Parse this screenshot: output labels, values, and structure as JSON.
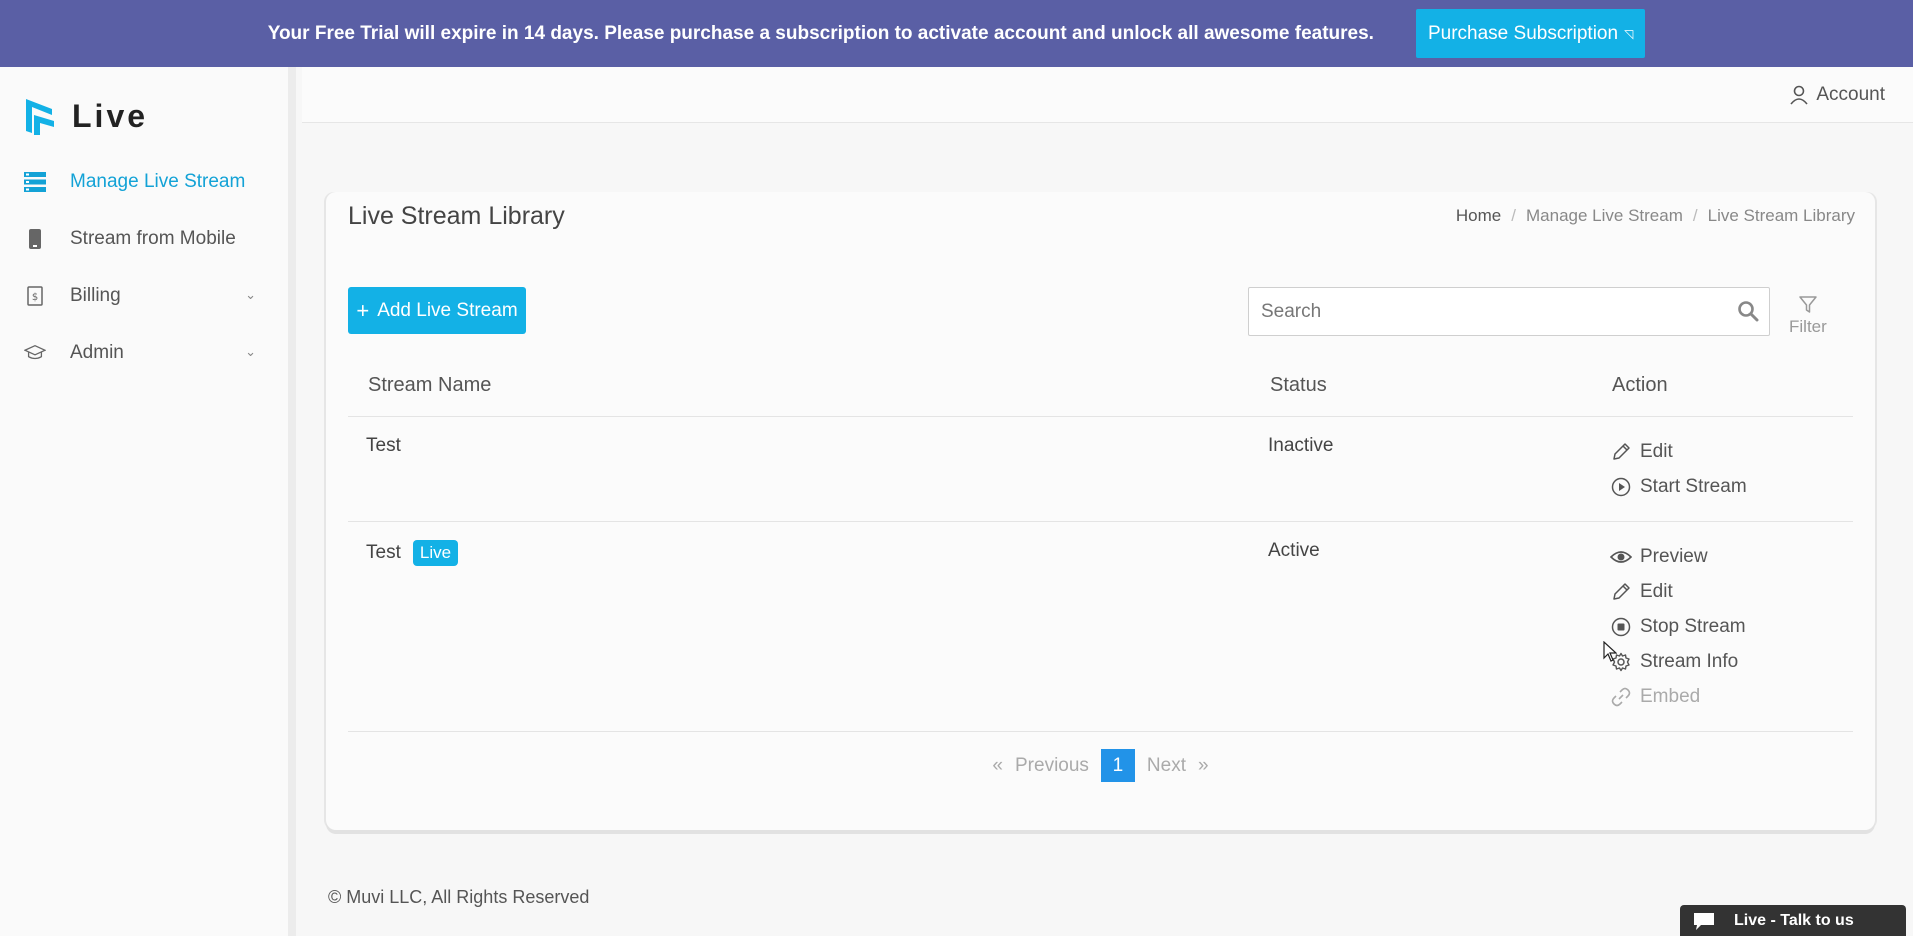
{
  "banner": {
    "message": "Your Free Trial will expire in 14 days. Please purchase a subscription to activate account and unlock all awesome features.",
    "button_label": "Purchase Subscription"
  },
  "sidebar": {
    "logo_text": "Live",
    "items": [
      {
        "label": "Manage Live Stream",
        "icon": "stream-list-icon",
        "active": true
      },
      {
        "label": "Stream from Mobile",
        "icon": "mobile-icon"
      },
      {
        "label": "Billing",
        "icon": "invoice-icon",
        "expandable": true
      },
      {
        "label": "Admin",
        "icon": "graduation-cap-icon",
        "expandable": true
      }
    ]
  },
  "header": {
    "account_label": "Account"
  },
  "page": {
    "title": "Live Stream Library",
    "breadcrumb": [
      "Home",
      "Manage Live Stream",
      "Live Stream Library"
    ],
    "add_button": "Add Live Stream",
    "search_placeholder": "Search",
    "filter_label": "Filter"
  },
  "table": {
    "columns": [
      "Stream Name",
      "Status",
      "Action"
    ],
    "rows": [
      {
        "name": "Test",
        "badge": "",
        "status": "Inactive",
        "actions": [
          "Edit",
          "Start Stream"
        ]
      },
      {
        "name": "Test",
        "badge": "Live",
        "status": "Active",
        "actions": [
          "Preview",
          "Edit",
          "Stop Stream",
          "Stream Info",
          "Embed"
        ]
      }
    ]
  },
  "pagination": {
    "previous": "Previous",
    "current": "1",
    "next": "Next",
    "prev_symbol": "«",
    "next_symbol": "»"
  },
  "footer": {
    "copyright": "© Muvi LLC, All Rights Reserved"
  },
  "chat": {
    "label": "Live - Talk to us"
  },
  "colors": {
    "accent": "#13b1e6",
    "banner": "#5a5fa5",
    "page_active": "#2293e8"
  }
}
